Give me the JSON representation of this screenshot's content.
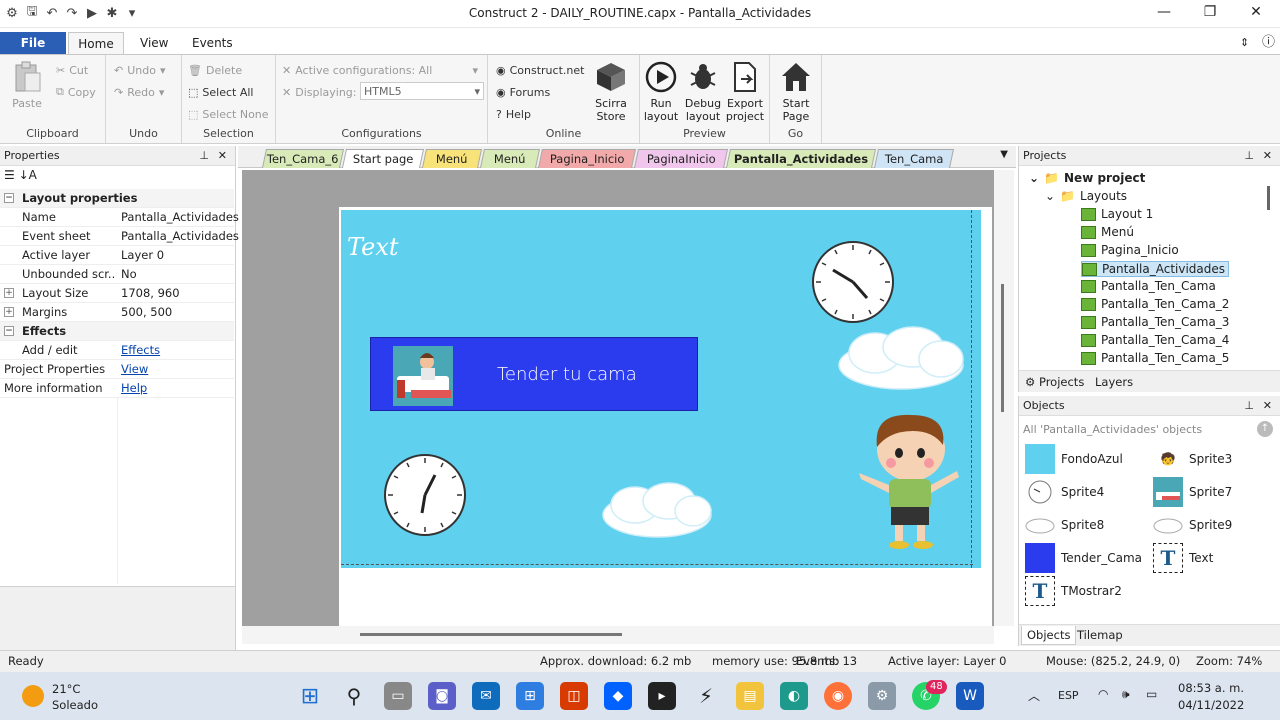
{
  "window": {
    "title": "Construct 2 - DAILY_ROUTINE.capx - Pantalla_Actividades"
  },
  "ribbon_tabs": [
    "File",
    "Home",
    "View",
    "Events"
  ],
  "ribbon": {
    "clipboard": {
      "paste": "Paste",
      "cut": "Cut",
      "copy": "Copy",
      "label": "Clipboard"
    },
    "undo": {
      "undo": "Undo",
      "redo": "Redo",
      "label": "Undo"
    },
    "selection": {
      "delete": "Delete",
      "select_all": "Select All",
      "select_none": "Select None",
      "label": "Selection"
    },
    "configurations": {
      "active": "Active configurations: All",
      "displaying": "Displaying:",
      "displaying_value": "HTML5",
      "label": "Configurations"
    },
    "online": {
      "construct": "Construct.net",
      "forums": "Forums",
      "help": "Help",
      "store": "Scirra Store",
      "label": "Online"
    },
    "preview": {
      "run": "Run layout",
      "debug": "Debug layout",
      "export": "Export project",
      "label": "Preview"
    },
    "go": {
      "start": "Start Page",
      "label": "Go"
    }
  },
  "properties": {
    "title": "Properties",
    "section_layout": "Layout properties",
    "rows": [
      {
        "k": "Name",
        "v": "Pantalla_Actividades"
      },
      {
        "k": "Event sheet",
        "v": "Pantalla_Actividades"
      },
      {
        "k": "Active layer",
        "v": "Layer 0"
      },
      {
        "k": "Unbounded scr...",
        "v": "No"
      },
      {
        "k": "Layout Size",
        "v": "1708, 960"
      },
      {
        "k": "Margins",
        "v": "500, 500"
      }
    ],
    "section_effects": "Effects",
    "add_edit": "Add / edit",
    "effects_link": "Effects",
    "project_properties": "Project Properties",
    "view_link": "View",
    "more_info": "More information",
    "help_link": "Help"
  },
  "doc_tabs": [
    {
      "label": "Ten_Cama_6",
      "color": "#d8eab8"
    },
    {
      "label": "Start page",
      "color": "#ffffff"
    },
    {
      "label": "Menú",
      "color": "#f7e37a"
    },
    {
      "label": "Menú",
      "color": "#d8eab8"
    },
    {
      "label": "Pagina_Inicio",
      "color": "#f2a9a9"
    },
    {
      "label": "PaginaInicio",
      "color": "#f0c6ec"
    },
    {
      "label": "Pantalla_Actividades",
      "color": "#d8eab8"
    },
    {
      "label": "Ten_Cama",
      "color": "#cfe4f5"
    }
  ],
  "layout_canvas": {
    "text_object": "Text",
    "button_label": "Tender tu cama"
  },
  "projects": {
    "title": "Projects",
    "root": "New project",
    "folder": "Layouts",
    "items": [
      "Layout 1",
      "Menú",
      "Pagina_Inicio",
      "Pantalla_Actividades",
      "Pantalla_Ten_Cama",
      "Pantalla_Ten_Cama_2",
      "Pantalla_Ten_Cama_3",
      "Pantalla_Ten_Cama_4",
      "Pantalla_Ten_Cama_5"
    ],
    "selected": "Pantalla_Actividades",
    "tabs": [
      "Projects",
      "Layers"
    ]
  },
  "objects": {
    "title": "Objects",
    "filter": "All 'Pantalla_Actividades' objects",
    "items": [
      "FondoAzul",
      "Sprite3",
      "Sprite4",
      "Sprite7",
      "Sprite8",
      "Sprite9",
      "Tender_Cama",
      "Text",
      "TMostrar2"
    ],
    "tabs": [
      "Objects",
      "Tilemap"
    ]
  },
  "status": {
    "ready": "Ready",
    "download": "Approx. download: 6.2 mb",
    "memory": "memory use: 95.8 mb",
    "events": "Events: 13",
    "layer": "Active layer: Layer 0",
    "mouse": "Mouse: (825.2, 24.9, 0)",
    "zoom": "Zoom: 74%"
  },
  "taskbar": {
    "weather_temp": "21°C",
    "weather_desc": "Soleado",
    "lang": "ESP",
    "time": "08:53 a. m.",
    "date": "04/11/2022",
    "whatsapp_badge": "48"
  }
}
